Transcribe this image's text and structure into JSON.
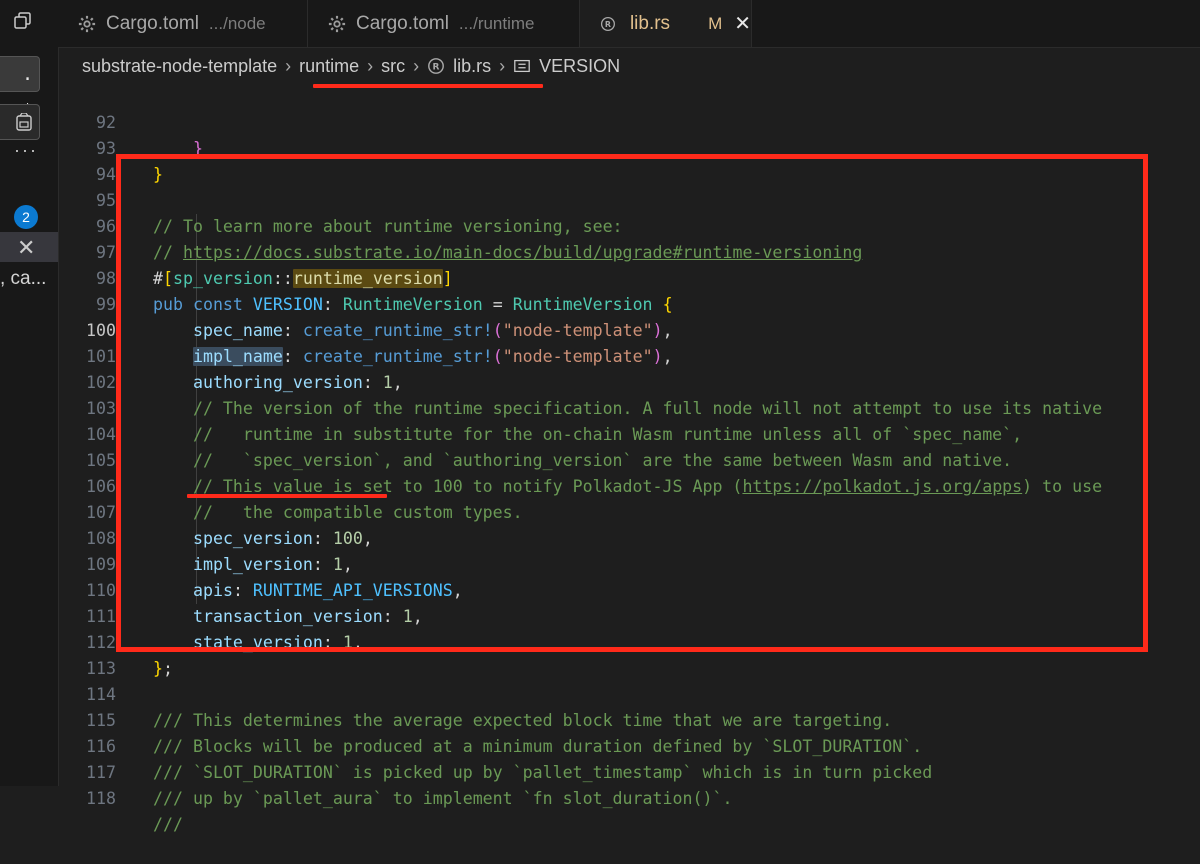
{
  "sidebar": {
    "regex_toggle": ". .*",
    "more": "···",
    "badge_count": "2",
    "close": "✕",
    "snippet": ", ca..."
  },
  "tabs": [
    {
      "label": "Cargo.toml",
      "description": ".../node",
      "icon": "gear-icon"
    },
    {
      "label": "Cargo.toml",
      "description": ".../runtime",
      "icon": "gear-icon"
    },
    {
      "label": "lib.rs",
      "description": "",
      "icon": "rust-icon",
      "modified": "M",
      "close": "✕"
    }
  ],
  "breadcrumb": {
    "items": [
      "substrate-node-template",
      "runtime",
      "src",
      "lib.rs",
      "VERSION"
    ]
  },
  "editor": {
    "current_line": 100,
    "line_numbers": [
      "92",
      "93",
      "94",
      "95",
      "96",
      "97",
      "98",
      "99",
      "100",
      "101",
      "102",
      "103",
      "104",
      "105",
      "106",
      "107",
      "108",
      "109",
      "110",
      "111",
      "112",
      "113",
      "114",
      "115",
      "116",
      "117",
      "118"
    ]
  },
  "colors": {
    "annotation_red": "#ff2a1a",
    "background": "#1e1e1e",
    "comment": "#6a9955",
    "keyword": "#569cd6",
    "type": "#4ec9b0",
    "string": "#ce9178",
    "number": "#b5cea8"
  }
}
